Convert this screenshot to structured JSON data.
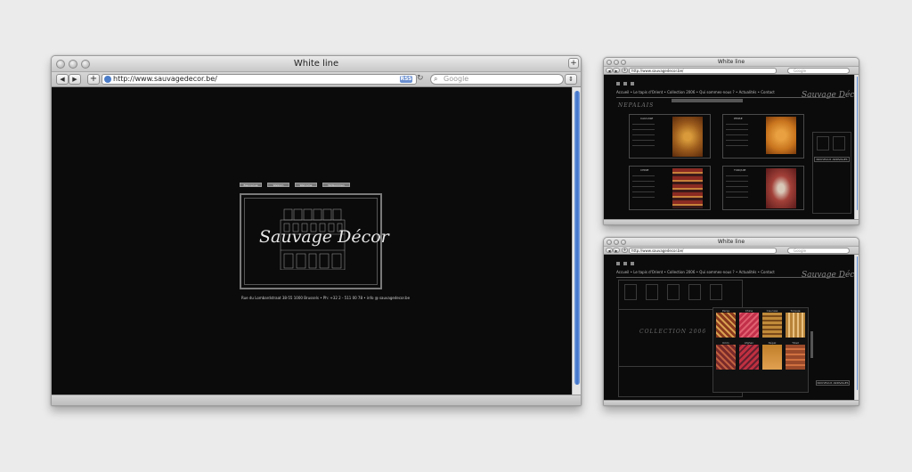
{
  "main_window": {
    "title": "White line",
    "url": "http://www.sauvagedecor.be/",
    "rss_label": "RSS",
    "search_placeholder": "Google",
    "site": {
      "menu": [
        "Bienvenue",
        "Welkom",
        "Welcome",
        "Willkommen"
      ],
      "logo": "Sauvage Décor",
      "address": "Rue du Lombardstraat 38-55 1000 Brussels • Ph: +32 2 - 511 00 78 • info @ sauvagedecor.be"
    }
  },
  "window_collection": {
    "title": "White line",
    "url": "http://www.sauvagedecor.be/",
    "search_placeholder": "Google",
    "nav": [
      "Accueil",
      "Le tapis d'Orient",
      "Collection 2006",
      "Qui sommes-nous ?",
      "Actualités",
      "Contact"
    ],
    "logo": "Sauvage Décor",
    "section_title": "NEPALAIS",
    "items": [
      {
        "name": "CAUCASE",
        "rug_color": "#9a5a1c"
      },
      {
        "name": "PERSE",
        "rug_color": "#c8741e"
      },
      {
        "name": "CHINE",
        "rug_color": "#8a2a22"
      },
      {
        "name": "TURQUIE",
        "rug_color": "#a24038"
      }
    ],
    "side_label": "NOUVEAUX ARRIVAGES"
  },
  "window_gallery": {
    "title": "White line",
    "url": "http://www.sauvagedecor.be/",
    "search_placeholder": "Google",
    "nav": [
      "Accueil",
      "Le tapis d'Orient",
      "Collection 2006",
      "Qui sommes-nous ?",
      "Actualités",
      "Contact"
    ],
    "logo": "Sauvage Décor",
    "overlay_title": "COLLECTION 2006",
    "rugs": [
      {
        "label": "Perse",
        "color": "#8a3a1e"
      },
      {
        "label": "Chine",
        "color": "#c2304a"
      },
      {
        "label": "Caucase",
        "color": "#c08a3a"
      },
      {
        "label": "Turquie",
        "color": "#b8843a"
      },
      {
        "label": "Kilim",
        "color": "#7a2a2a"
      },
      {
        "label": "Afghan",
        "color": "#c03040"
      },
      {
        "label": "Népal",
        "color": "#c0802a"
      },
      {
        "label": "Tibet",
        "color": "#9a4a2a"
      }
    ],
    "side_label": "NOUVEAUX ARRIVAGES"
  }
}
